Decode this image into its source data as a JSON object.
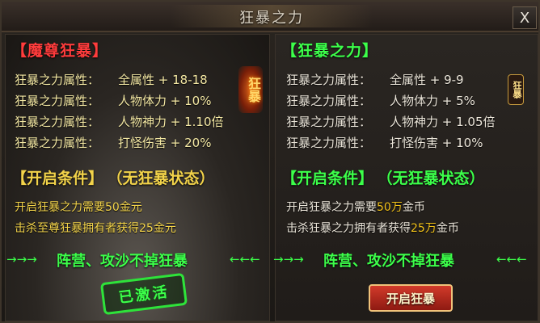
{
  "window": {
    "title": "狂暴之力",
    "close_label": "X"
  },
  "left": {
    "heading": "【魔尊狂暴】",
    "emblem": "狂暴",
    "attributes": [
      {
        "name": "狂暴之力属性：",
        "value": "全属性 + 18-18"
      },
      {
        "name": "狂暴之力属性：",
        "value": "人物体力 + 10%"
      },
      {
        "name": "狂暴之力属性：",
        "value": "人物神力 + 1.10倍"
      },
      {
        "name": "狂暴之力属性：",
        "value": "打怪伤害 + 20%"
      }
    ],
    "conditions_heading": "【开启条件】",
    "conditions_state": "（无狂暴状态）",
    "conditions": [
      "开启狂暴之力需要50金元",
      "击杀至尊狂暴拥有者获得25金元"
    ],
    "banner_arrows_left": "→→→",
    "banner": "阵营、攻沙不掉狂暴",
    "banner_arrows_right": "←←←",
    "stamp": "已激活"
  },
  "right": {
    "heading": "【狂暴之力】",
    "emblem": "狂暴",
    "attributes": [
      {
        "name": "狂暴之力属性：",
        "value": "全属性 + 9-9"
      },
      {
        "name": "狂暴之力属性：",
        "value": "人物体力 + 5%"
      },
      {
        "name": "狂暴之力属性：",
        "value": "人物神力 + 1.05倍"
      },
      {
        "name": "狂暴之力属性：",
        "value": "打怪伤害 + 10%"
      }
    ],
    "conditions_heading": "【开启条件】",
    "conditions_state": "（无狂暴状态）",
    "conditions": [
      {
        "pre": "开启狂暴之力需要",
        "amount": "50万",
        "post": "金币"
      },
      {
        "pre": "击杀狂暴之力拥有者获得",
        "amount": "25万",
        "post": "金币"
      }
    ],
    "banner_arrows_left": "→→→",
    "banner": "阵营、攻沙不掉狂暴",
    "banner_arrows_right": "←←←",
    "activate_button": "开启狂暴"
  },
  "colors": {
    "red_heading": "#ff3c3c",
    "green_heading": "#3cff4a",
    "gold_text": "#f2d34a",
    "attr_yellow": "#f5e9a4"
  }
}
